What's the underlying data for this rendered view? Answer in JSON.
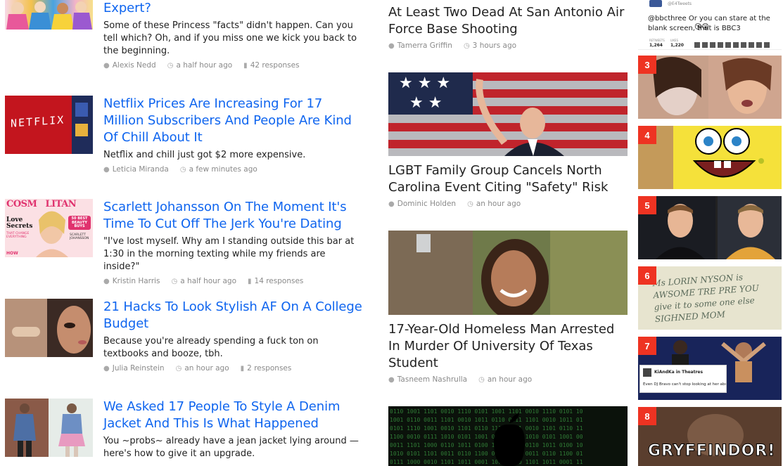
{
  "left_feed": [
    {
      "headline": "Expert?",
      "dek": "Some of these Princess \"facts\" didn't happen. Can you tell which? Oh, and if you miss one we kick you back to the beginning.",
      "author": "Alexis Nedd",
      "time": "a half hour ago",
      "responses": "42 responses"
    },
    {
      "headline": "Netflix Prices Are Increasing For 17 Million Subscribers And People Are Kind Of Chill About It",
      "dek": "Netflix and chill just got $2 more expensive.",
      "author": "Leticia Miranda",
      "time": "a few minutes ago",
      "thumb_text": "NETFLIX"
    },
    {
      "headline": "Scarlett Johansson On The Moment It's Time To Cut Off The Jerk You're Dating",
      "dek": "\"I've lost myself. Why am I standing outside this bar at 1:30 in the morning texting while my friends are inside?\"",
      "author": "Kristin Harris",
      "time": "a half hour ago",
      "responses": "14 responses",
      "thumb_text": {
        "masthead": "COSM   LITAN",
        "cover_left": "Love Secrets",
        "cover_left_sub": "THAT CHANGE EVERYTHING",
        "cover_badge": "50 BEST BEAUTY BUYS",
        "cover_name": "SCARLETT JOHANSSON",
        "cover_bottom": "HOW"
      }
    },
    {
      "headline": "21 Hacks To Look Stylish AF On A College Budget",
      "dek": "Because you're already spending a fuck ton on textbooks and booze, tbh.",
      "author": "Julia Reinstein",
      "time": "an hour ago",
      "responses": "2 responses"
    },
    {
      "headline": "We Asked 17 People To Style A Denim Jacket And This Is What Happened",
      "dek": "You ~probs~ already have a jean jacket lying around — here's how to give it an upgrade."
    }
  ],
  "middle": [
    {
      "headline": "At Least Two Dead At San Antonio Air Force Base Shooting",
      "author": "Tamerra Griffin",
      "time": "3 hours ago"
    },
    {
      "headline": "LGBT Family Group Cancels North Carolina Event Citing \"Safety\" Risk",
      "author": "Dominic Holden",
      "time": "an hour ago"
    },
    {
      "headline": "17-Year-Old Homeless Man Arrested In Murder Of University Of Texas Student",
      "author": "Tasneem Nashrulla",
      "time": "an hour ago"
    }
  ],
  "trending": {
    "tweet_text": "@bbcthree Or you can stare at the blank screen, that is BBC3",
    "tweet_handle": "@E4Tweets",
    "tweet_stats": [
      "RETWEETS",
      "LIKES"
    ],
    "tweet_counts": [
      "1,264",
      "1,220"
    ],
    "ranks": [
      "3",
      "4",
      "5",
      "6",
      "7",
      "8"
    ],
    "item7_tweet_name": "KiAndKa in Theatres",
    "item7_tweet_text": "Even DJ Bravo can't stop looking at her abs",
    "item6_scribble": "Ms LORIN NYSON is AWSOME TRE PRE YOU give it to some one else SIGHNED MOM",
    "item8_text": "GRYFFINDOR!"
  },
  "colors": {
    "link_blue": "#0f65ef",
    "rank_red": "#ee3322",
    "meta_gray": "#8a8a8a"
  },
  "icons": [
    "user-icon",
    "clock-icon",
    "comment-icon"
  ]
}
